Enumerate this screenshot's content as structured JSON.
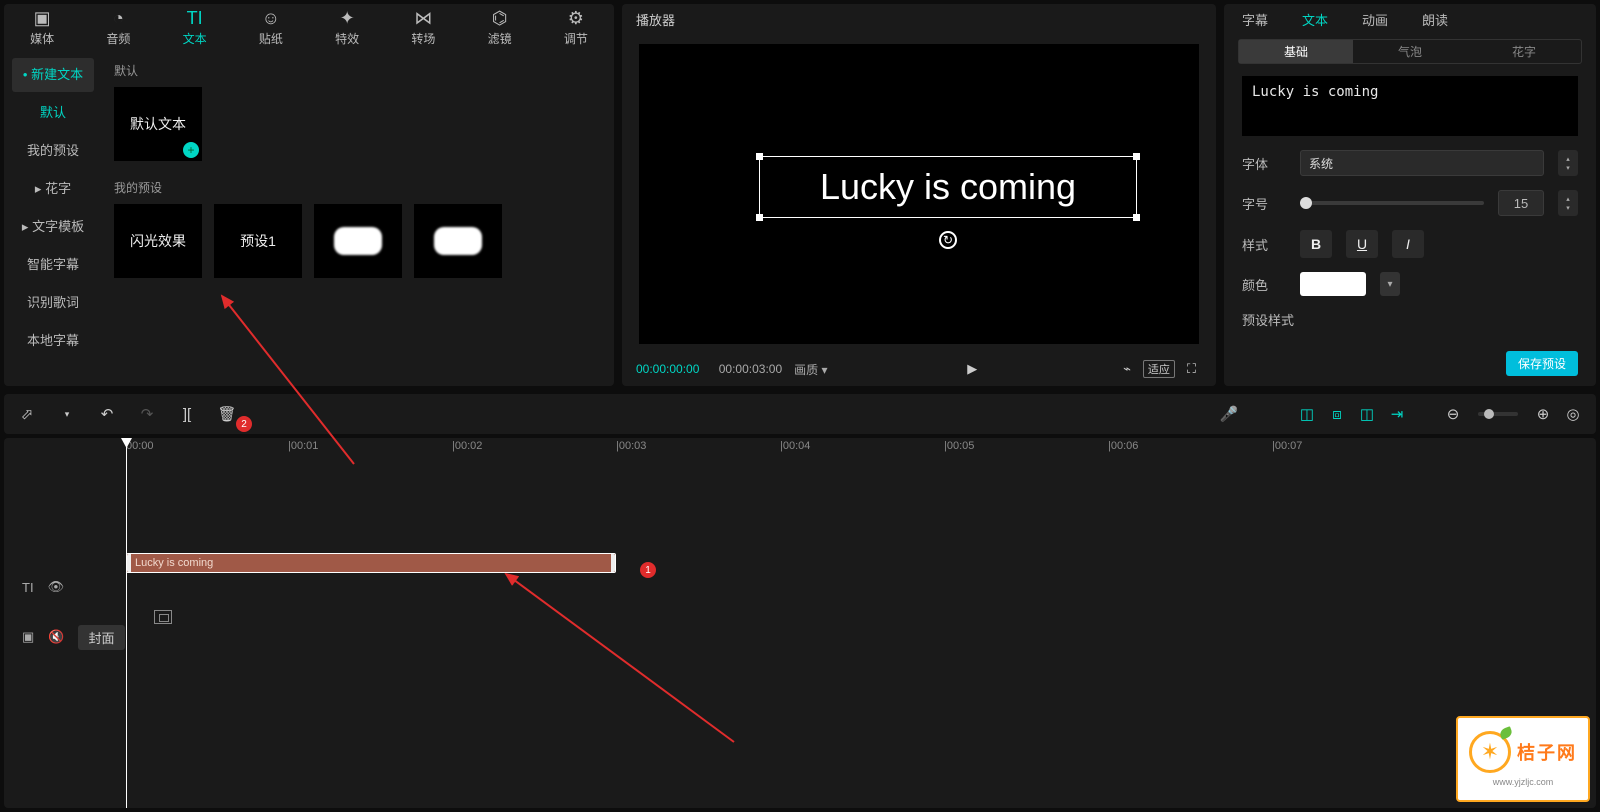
{
  "top_tabs": {
    "media": "媒体",
    "audio": "音频",
    "text": "文本",
    "sticker": "贴纸",
    "effect": "特效",
    "transition": "转场",
    "filter": "滤镜",
    "adjust": "调节"
  },
  "asset_sidebar": {
    "new_text": "新建文本",
    "default": "默认",
    "my_presets": "我的预设",
    "fancy_text": "花字",
    "text_template": "文字模板",
    "smart_subtitle": "智能字幕",
    "lyrics": "识别歌词",
    "local_subtitle": "本地字幕"
  },
  "asset_content": {
    "section_default": "默认",
    "thumb_default": "默认文本",
    "section_my": "我的预设",
    "thumb_p1": "闪光效果",
    "thumb_p2": "预设1"
  },
  "player": {
    "title": "播放器",
    "overlay_text": "Lucky is coming",
    "time_current": "00:00:00:00",
    "time_total": "00:00:03:00",
    "quality": "画质",
    "fit": "适应"
  },
  "inspector": {
    "tabs": {
      "subtitle": "字幕",
      "text": "文本",
      "anim": "动画",
      "tts": "朗读"
    },
    "subtabs": {
      "basic": "基础",
      "bubble": "气泡",
      "fancy": "花字"
    },
    "editor_value": "Lucky is coming",
    "font_label": "字体",
    "font_value": "系统",
    "size_label": "字号",
    "size_value": "15",
    "style_label": "样式",
    "color_label": "颜色",
    "preset_style_label": "预设样式",
    "save_preset": "保存预设"
  },
  "timeline": {
    "clip_label": "Lucky is coming",
    "cover": "封面",
    "ticks": [
      "00:00",
      "|00:01",
      "|00:02",
      "|00:03",
      "|00:04",
      "|00:05",
      "|00:06",
      "|00:07"
    ]
  },
  "annotations": {
    "n1": "1",
    "n2": "2"
  },
  "watermark": {
    "brand": "桔子网",
    "url": "www.yjzljc.com"
  }
}
